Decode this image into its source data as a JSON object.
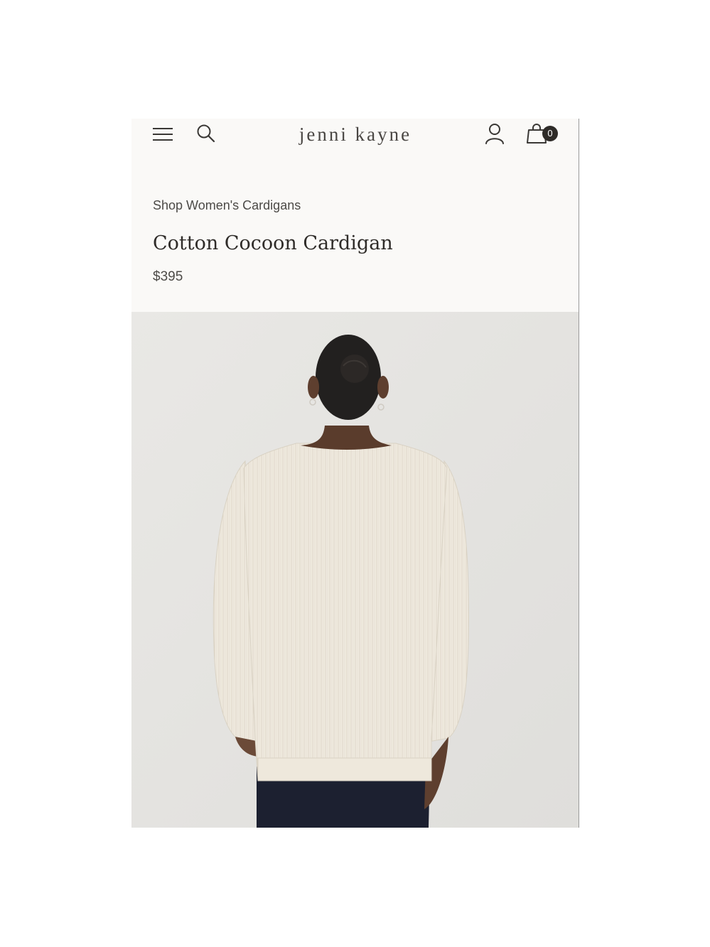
{
  "header": {
    "menu_icon": "hamburger-menu-icon",
    "search_icon": "search-icon",
    "brand": "jenni kayne",
    "account_icon": "account-icon",
    "bag_icon": "shopping-bag-icon",
    "bag_count": "0"
  },
  "breadcrumb": {
    "label": "Shop Women's Cardigans"
  },
  "product": {
    "title": "Cotton Cocoon Cardigan",
    "price": "$395",
    "image_alt_icon": "product-photo"
  },
  "colors": {
    "page_background": "#ffffff",
    "screen_background": "#faf9f7",
    "photo_background": "#e6e5e2",
    "text_dark": "#2f2c29",
    "text_muted": "#4c4a47",
    "badge": "#2e2b28"
  }
}
